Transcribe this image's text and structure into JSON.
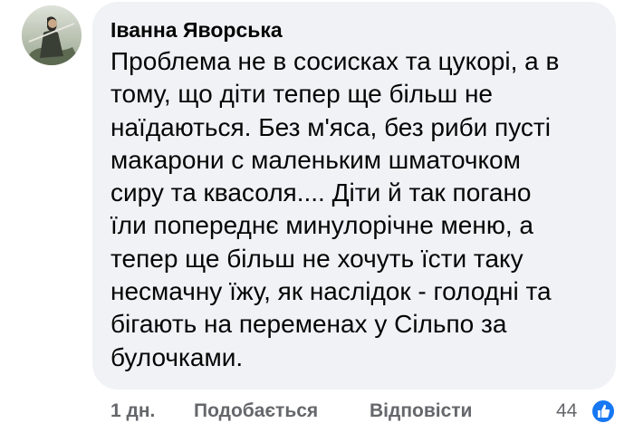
{
  "comment": {
    "author": "Іванна Яворська",
    "text_lines": [
      "Проблема не в сосисках та цукорі, а в",
      "тому, що діти тепер ще більш не",
      "наїдаються. Без м'яса, без риби пусті",
      "макарони с маленьким шматочком",
      "сиру та квасоля.... Діти й так погано",
      "їли попереднє минулорічне меню, а",
      "тепер ще більш не хочуть їсти таку",
      "несмачну їжу, як наслідок - голодні та",
      "бігають на переменах у Сільпо за",
      "булочками."
    ],
    "timestamp": "1 дн.",
    "like_label": "Подобається",
    "reply_label": "Відповісти",
    "reaction_count": "44",
    "reaction_icon": "thumbs-up-icon",
    "reaction_color": "#1877f2"
  }
}
